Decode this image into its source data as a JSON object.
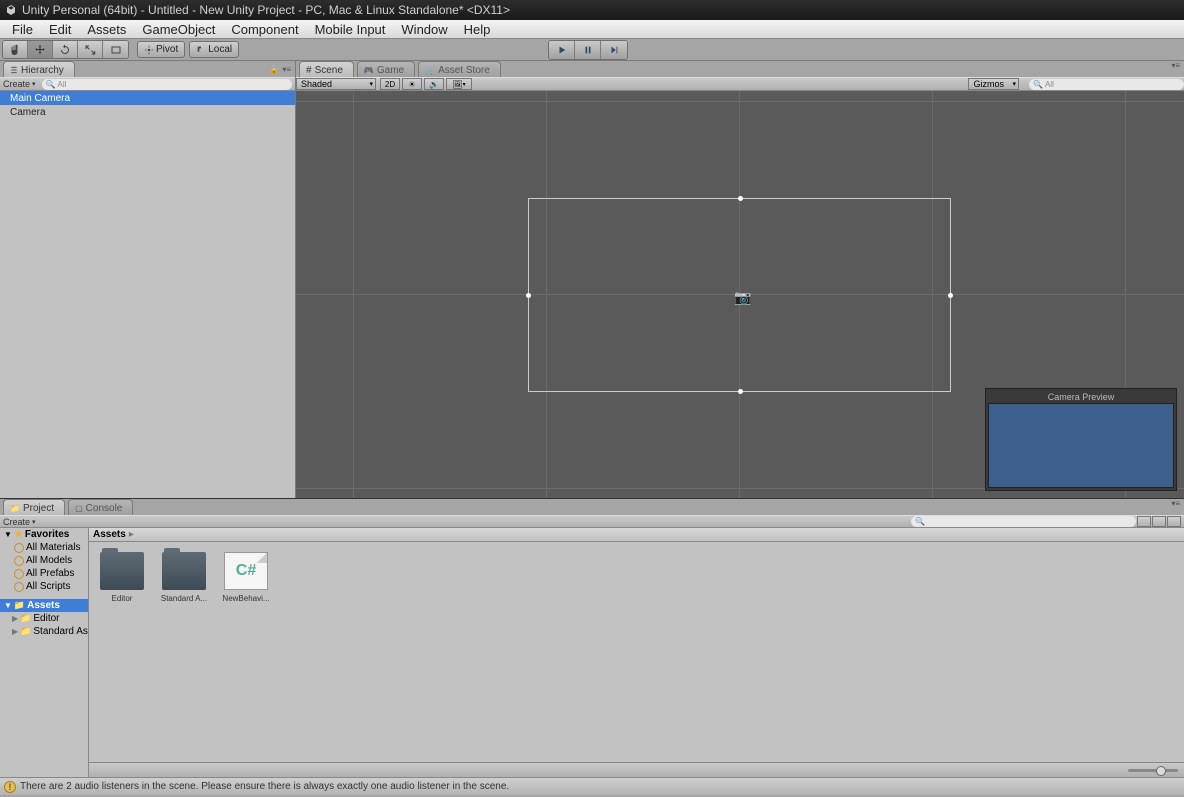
{
  "title": "Unity Personal (64bit) - Untitled - New Unity Project - PC, Mac & Linux Standalone* <DX11>",
  "menu": [
    "File",
    "Edit",
    "Assets",
    "GameObject",
    "Component",
    "Mobile Input",
    "Window",
    "Help"
  ],
  "toolbar": {
    "pivot": "Pivot",
    "local": "Local"
  },
  "hierarchy": {
    "tab": "Hierarchy",
    "create": "Create",
    "search_placeholder": "All",
    "footer_icons": true,
    "items": [
      {
        "name": "Main Camera",
        "selected": true
      },
      {
        "name": "Camera",
        "selected": false
      }
    ]
  },
  "scene": {
    "tabs": [
      {
        "label": "Scene",
        "active": true
      },
      {
        "label": "Game",
        "active": false
      },
      {
        "label": "Asset Store",
        "active": false
      }
    ],
    "shading": "Shaded",
    "twoD": "2D",
    "gizmos": "Gizmos",
    "search_placeholder": "All",
    "camera_preview": "Camera Preview"
  },
  "project": {
    "tabs": [
      {
        "label": "Project",
        "active": true
      },
      {
        "label": "Console",
        "active": false
      }
    ],
    "create": "Create",
    "favorites": "Favorites",
    "fav_items": [
      "All Materials",
      "All Models",
      "All Prefabs",
      "All Scripts"
    ],
    "assets_root": "Assets",
    "tree_items": [
      "Editor",
      "Standard As"
    ],
    "breadcrumb": "Assets",
    "grid": [
      {
        "name": "Editor",
        "type": "folder"
      },
      {
        "name": "Standard A...",
        "type": "folder"
      },
      {
        "name": "NewBehavi...",
        "type": "script"
      }
    ]
  },
  "status": {
    "message": "There are 2 audio listeners in the scene. Please ensure there is always exactly one audio listener in the scene."
  }
}
